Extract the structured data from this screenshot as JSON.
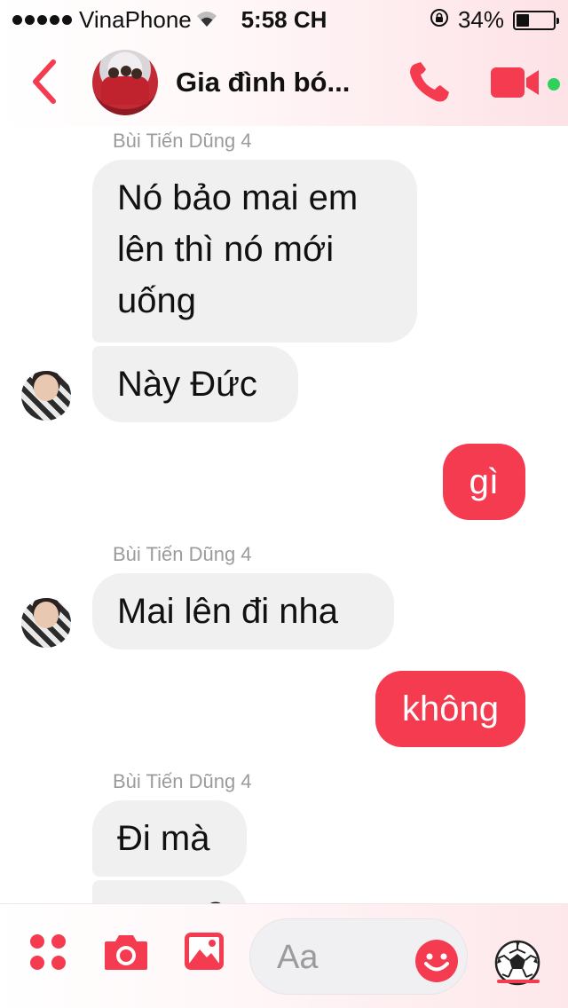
{
  "status_bar": {
    "carrier": "VinaPhone",
    "time": "5:58 CH",
    "battery_percent": "34%",
    "battery_level": 0.34
  },
  "header": {
    "title": "Gia đình bó..."
  },
  "messages": {
    "sender_1": "Bùi Tiến Dũng 4",
    "in_1": "Nó bảo mai em lên thì nó mới uống",
    "in_1_line1": "Nó bảo mai em",
    "in_1_line2": "lên thì nó mới",
    "in_1_line3": "uống",
    "in_2": "Này Đức",
    "out_1": "gì",
    "sender_2": "Bùi Tiến Dũng 4",
    "in_3": "Mai lên đi nha",
    "out_2": "không",
    "sender_3": "Bùi Tiến Dũng 4",
    "in_4": "Đi mà",
    "in_5_partial": "ạ"
  },
  "composer": {
    "placeholder": "Aa"
  },
  "colors": {
    "accent": "#f43b50",
    "incoming_bubble": "#f0f0f0",
    "sender_name": "#9b9b9b",
    "online": "#2fd15b"
  },
  "icons": {
    "back": "chevron-left-icon",
    "call": "phone-icon",
    "video": "video-camera-icon",
    "apps": "four-dots-icon",
    "camera": "camera-icon",
    "gallery": "image-icon",
    "emoji": "smiley-icon",
    "quick_reaction": "soccer-ball-icon"
  }
}
